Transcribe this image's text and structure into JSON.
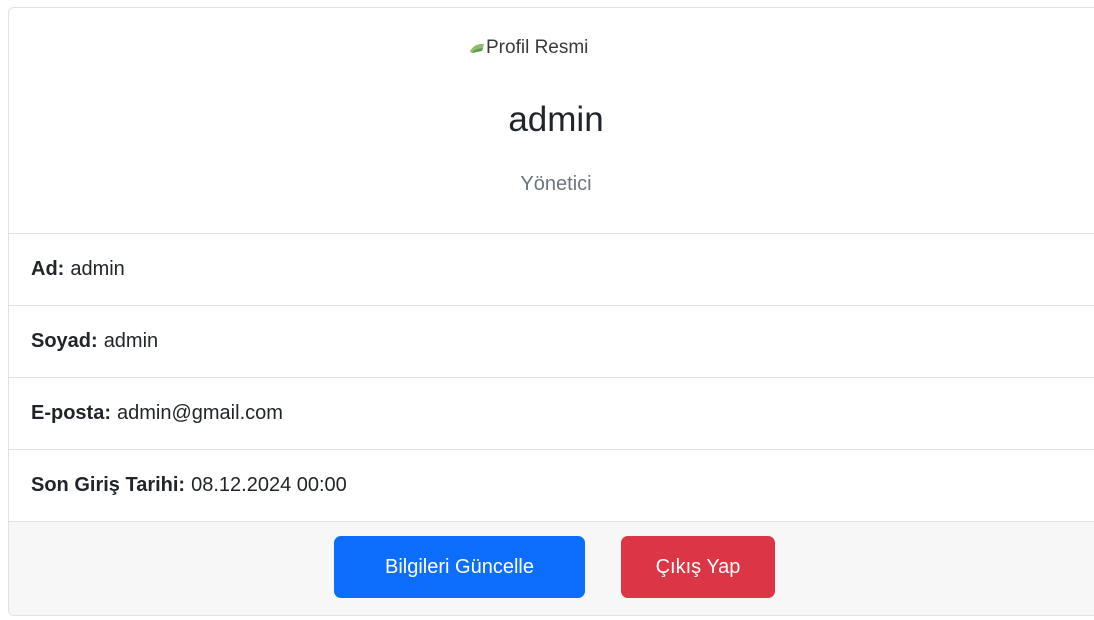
{
  "profile": {
    "image_alt": "Profil Resmi",
    "username": "admin",
    "role": "Yönetici"
  },
  "details": [
    {
      "label": "Ad:",
      "value": "admin"
    },
    {
      "label": "Soyad:",
      "value": "admin"
    },
    {
      "label": "E-posta:",
      "value": "admin@gmail.com"
    },
    {
      "label": "Son Giriş Tarihi:",
      "value": "08.12.2024 00:00"
    }
  ],
  "actions": {
    "update_label": "Bilgileri Güncelle",
    "logout_label": "Çıkış Yap"
  },
  "colors": {
    "primary": "#0d6efd",
    "danger": "#dc3545",
    "muted": "#6c757d",
    "footer_bg": "#f7f7f7",
    "border": "#dfe2e6"
  }
}
